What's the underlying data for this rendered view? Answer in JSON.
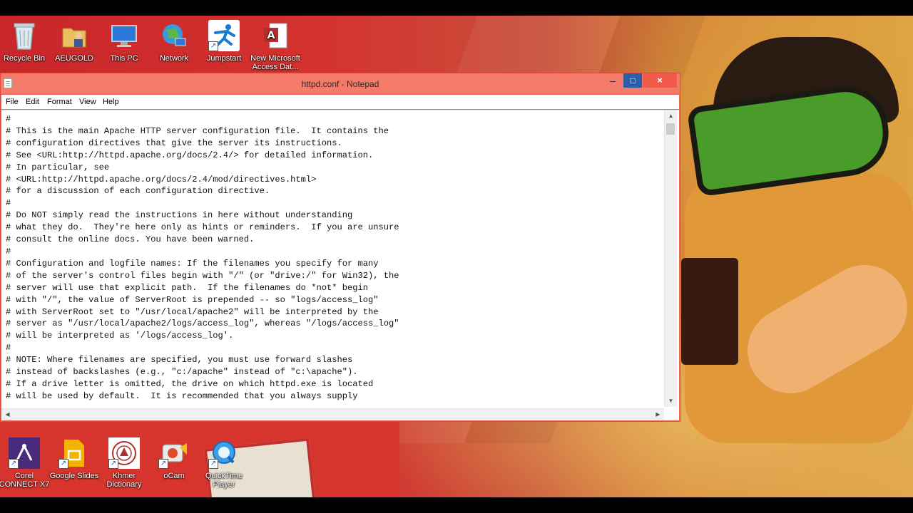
{
  "desktop": {
    "top_icons": [
      {
        "name": "recycle-bin-icon",
        "label": "Recycle Bin"
      },
      {
        "name": "user-folder-icon",
        "label": "AEUGOLD"
      },
      {
        "name": "this-pc-icon",
        "label": "This PC"
      },
      {
        "name": "network-icon",
        "label": "Network"
      },
      {
        "name": "jumpstart-icon",
        "label": "Jumpstart"
      },
      {
        "name": "access-database-icon",
        "label": "New Microsoft Access Dat..."
      }
    ],
    "bottom_icons": [
      {
        "name": "corel-connect-icon",
        "label": "Corel CONNECT X7"
      },
      {
        "name": "google-slides-icon",
        "label": "Google Slides"
      },
      {
        "name": "khmer-dictionary-icon",
        "label": "Khmer Dictionary"
      },
      {
        "name": "ocam-icon",
        "label": "oCam"
      },
      {
        "name": "quicktime-player-icon",
        "label": "QuickTime Player"
      }
    ]
  },
  "window": {
    "title": "httpd.conf - Notepad",
    "controls": {
      "minimize": "–",
      "maximize": "□",
      "close": "×"
    },
    "menu": [
      "File",
      "Edit",
      "Format",
      "View",
      "Help"
    ],
    "colors": {
      "titlebar": "#f47a6a",
      "maximize": "#2b5ea8",
      "close": "#f05a4a"
    }
  },
  "document": {
    "lines": [
      "#",
      "# This is the main Apache HTTP server configuration file.  It contains the",
      "# configuration directives that give the server its instructions.",
      "# See <URL:http://httpd.apache.org/docs/2.4/> for detailed information.",
      "# In particular, see",
      "# <URL:http://httpd.apache.org/docs/2.4/mod/directives.html>",
      "# for a discussion of each configuration directive.",
      "#",
      "# Do NOT simply read the instructions in here without understanding",
      "# what they do.  They're here only as hints or reminders.  If you are unsure",
      "# consult the online docs. You have been warned.",
      "#",
      "# Configuration and logfile names: If the filenames you specify for many",
      "# of the server's control files begin with \"/\" (or \"drive:/\" for Win32), the",
      "# server will use that explicit path.  If the filenames do *not* begin",
      "# with \"/\", the value of ServerRoot is prepended -- so \"logs/access_log\"",
      "# with ServerRoot set to \"/usr/local/apache2\" will be interpreted by the",
      "# server as \"/usr/local/apache2/logs/access_log\", whereas \"/logs/access_log\"",
      "# will be interpreted as '/logs/access_log'.",
      "#",
      "# NOTE: Where filenames are specified, you must use forward slashes",
      "# instead of backslashes (e.g., \"c:/apache\" instead of \"c:\\apache\").",
      "# If a drive letter is omitted, the drive on which httpd.exe is located",
      "# will be used by default.  It is recommended that you always supply"
    ]
  }
}
